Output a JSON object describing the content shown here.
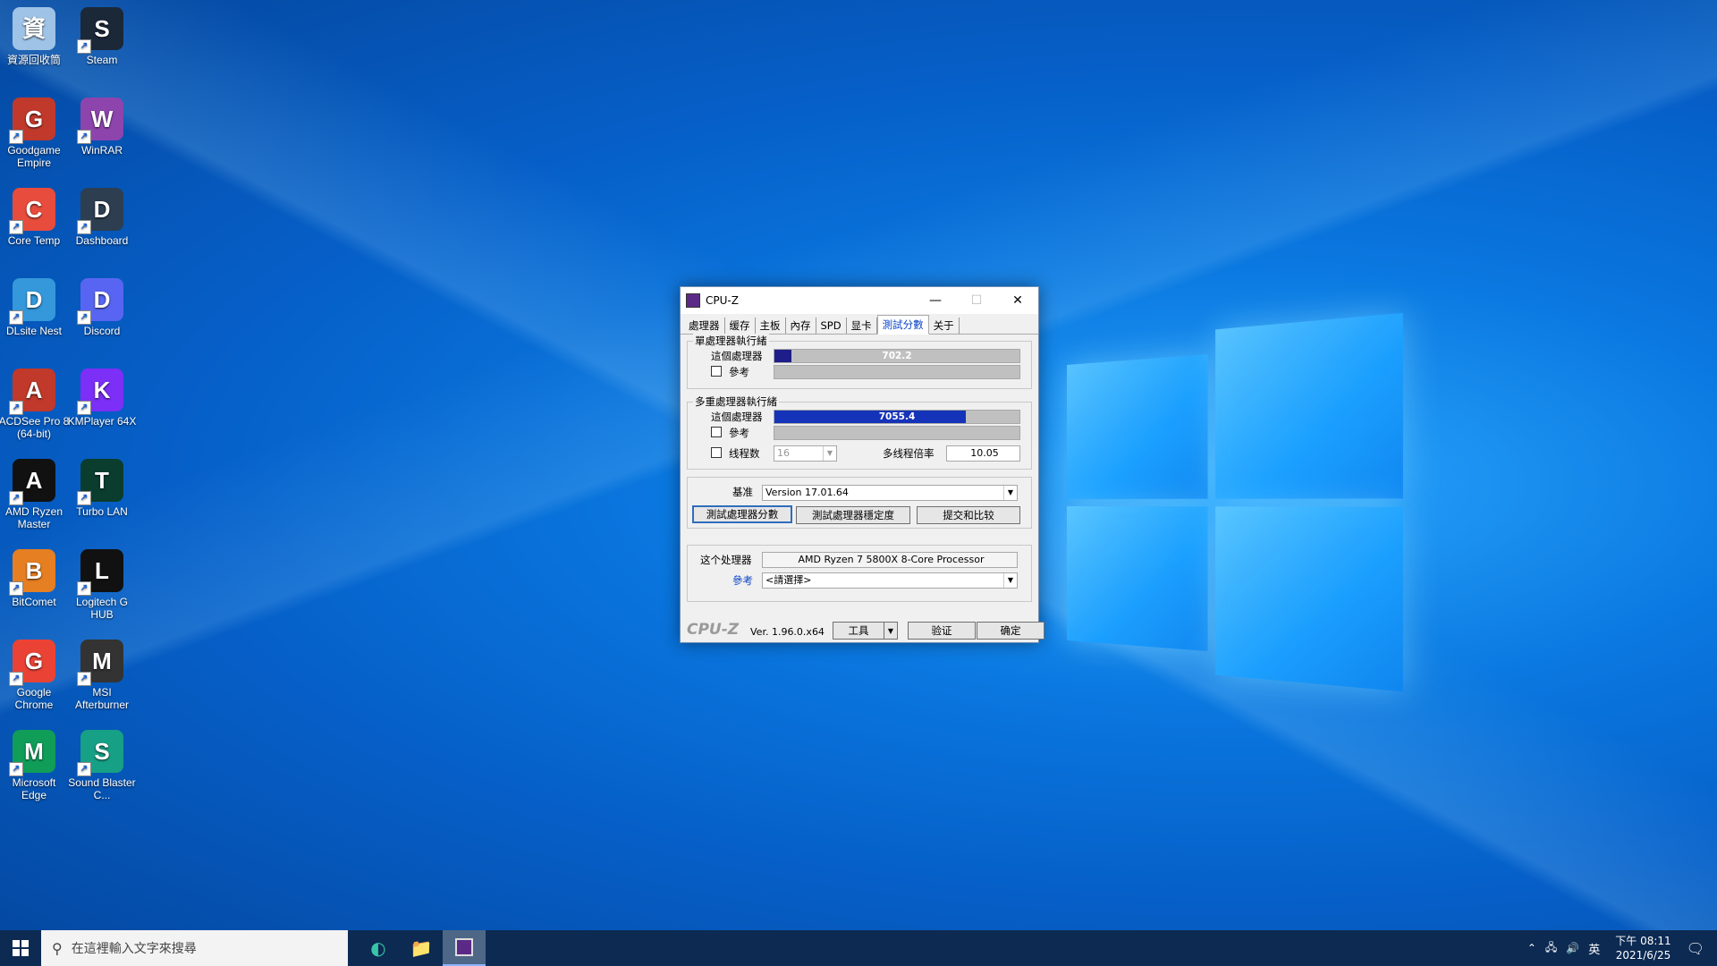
{
  "desktop": {
    "icons": [
      {
        "label": "資源回收筒",
        "icon": "recycle-bin-icon",
        "color": "#9fc3e6"
      },
      {
        "label": "Steam",
        "icon": "steam-icon",
        "color": "#1b2838"
      },
      {
        "label": "Goodgame Empire",
        "icon": "goodgame-empire-icon",
        "color": "#c0392b"
      },
      {
        "label": "WinRAR",
        "icon": "winrar-icon",
        "color": "#8e44ad"
      },
      {
        "label": "Core Temp",
        "icon": "core-temp-icon",
        "color": "#e74c3c"
      },
      {
        "label": "Dashboard",
        "icon": "dashboard-icon",
        "color": "#2c3e50"
      },
      {
        "label": "DLsite Nest",
        "icon": "dlsite-nest-icon",
        "color": "#3498db"
      },
      {
        "label": "Discord",
        "icon": "discord-icon",
        "color": "#5865f2"
      },
      {
        "label": "ACDSee Pro 8 (64-bit)",
        "icon": "acdsee-icon",
        "color": "#c0392b"
      },
      {
        "label": "KMPlayer 64X",
        "icon": "kmplayer-icon",
        "color": "#7b2ff7"
      },
      {
        "label": "AMD Ryzen Master",
        "icon": "ryzen-master-icon",
        "color": "#111111"
      },
      {
        "label": "Turbo LAN",
        "icon": "turbo-lan-icon",
        "color": "#0b3d2e"
      },
      {
        "label": "BitComet",
        "icon": "bitcomet-icon",
        "color": "#e67e22"
      },
      {
        "label": "Logitech G HUB",
        "icon": "logitech-g-hub-icon",
        "color": "#111111"
      },
      {
        "label": "Google Chrome",
        "icon": "chrome-icon",
        "color": "#ea4335"
      },
      {
        "label": "MSI Afterburner",
        "icon": "msi-afterburner-icon",
        "color": "#333333"
      },
      {
        "label": "Microsoft Edge",
        "icon": "edge-icon",
        "color": "#0f9d58"
      },
      {
        "label": "Sound Blaster C...",
        "icon": "sound-blaster-icon",
        "color": "#16a085"
      }
    ]
  },
  "window": {
    "title": "CPU-Z",
    "tabs": [
      "處理器",
      "缓存",
      "主板",
      "內存",
      "SPD",
      "显卡",
      "測試分數",
      "关于"
    ],
    "active_tab": "測試分數",
    "single": {
      "group_label": "單處理器執行緒",
      "this_label": "這個處理器",
      "this_value": "702.2",
      "this_fraction": 0.07,
      "ref_label": "參考"
    },
    "multi": {
      "group_label": "多重處理器執行緒",
      "this_label": "這個處理器",
      "this_value": "7055.4",
      "this_fraction": 0.78,
      "ref_label": "參考",
      "threads_label": "线程数",
      "threads_value": "16",
      "ratio_label": "多线程倍率",
      "ratio_value": "10.05"
    },
    "bench": {
      "label": "基准",
      "version": "Version 17.01.64",
      "btn_bench": "測試處理器分數",
      "btn_stress": "測試處理器穩定度",
      "btn_submit": "提交和比较"
    },
    "proc": {
      "this_label": "这个处理器",
      "this_value": "AMD Ryzen 7 5800X 8-Core Processor",
      "ref_label": "參考",
      "ref_value": "<請選擇>"
    },
    "footer": {
      "brand": "CPU-Z",
      "version": "Ver. 1.96.0.x64",
      "tools": "工具",
      "validate": "验证",
      "ok": "确定"
    }
  },
  "taskbar": {
    "search_placeholder": "在這裡輸入文字來搜尋",
    "ime": "英",
    "time": "下午 08:11",
    "date": "2021/6/25"
  }
}
